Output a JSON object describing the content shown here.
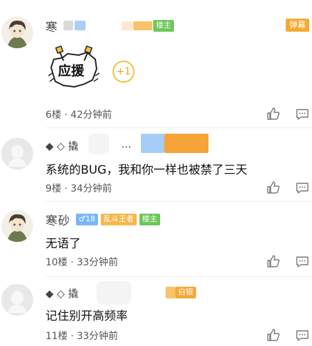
{
  "comments": [
    {
      "username": "寒",
      "badge_owner": "楼主",
      "danmu_label": "弹幕",
      "sticker_text": "应援",
      "plus_one": "+1",
      "floor": "6楼",
      "time": "42分钟前",
      "meta_sep": "·"
    },
    {
      "username": "◆ ◇ 撬",
      "dots": "…",
      "text": "系统的BUG，我和你一样也被禁了三天",
      "floor": "9楼",
      "time": "34分钟前",
      "meta_sep": "·"
    },
    {
      "username": "寒砂",
      "badge_gender": "♂18",
      "badge_rank": "乱斗王者",
      "badge_owner": "楼主",
      "text": "无语了",
      "floor": "10楼",
      "time": "33分钟前",
      "meta_sep": "·"
    },
    {
      "username": "◆ ◇ 撬",
      "badge_silver": "白银",
      "text": "记住别开高频率",
      "floor": "11楼",
      "time": "33分钟前",
      "meta_sep": "·"
    }
  ],
  "icons": {
    "like": "thumbs-up-icon",
    "reply": "comment-icon"
  },
  "colors": {
    "owner_badge": "#6cc75a",
    "rank_badge": "#f6b74b",
    "gender_badge": "#7ab6f7",
    "danmu": "#f6a930",
    "plus_one": "#f3c13a"
  }
}
